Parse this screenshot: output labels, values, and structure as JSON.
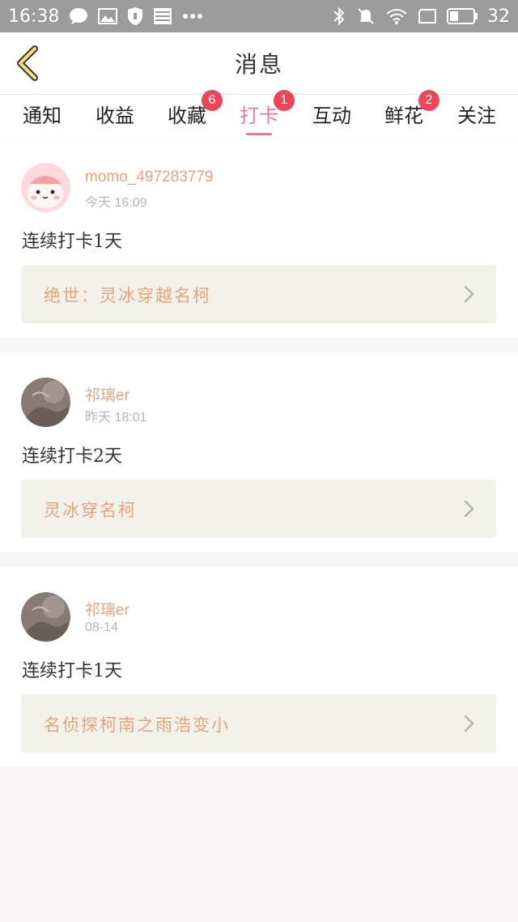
{
  "status_bar": {
    "time": "16:38",
    "battery_percent": "32",
    "icons": [
      "chat-icon",
      "image-icon",
      "shield-icon",
      "news-icon",
      "more-dots-icon",
      "bluetooth-icon",
      "mute-icon",
      "wifi-icon",
      "screen-icon",
      "battery-icon"
    ]
  },
  "header": {
    "title": "消息",
    "back_icon": "chevron-left-icon"
  },
  "tabs": [
    {
      "label": "通知",
      "badge": ""
    },
    {
      "label": "收益",
      "badge": ""
    },
    {
      "label": "收藏",
      "badge": "6"
    },
    {
      "label": "打卡",
      "badge": "1",
      "active": true
    },
    {
      "label": "互动",
      "badge": ""
    },
    {
      "label": "鲜花",
      "badge": "2"
    },
    {
      "label": "关注",
      "badge": ""
    }
  ],
  "colors": {
    "accent_pink": "#e07aa2",
    "badge_red": "#f04458",
    "username_orange": "#e3a47e",
    "book_bg": "#f3f2ea"
  },
  "feed": [
    {
      "username": "momo_497283779",
      "time": "今天  16:09",
      "message": "连续打卡1天",
      "book": "绝世：灵冰穿越名柯"
    },
    {
      "username": "祁璃er",
      "time": "昨天  18:01",
      "message": "连续打卡2天",
      "book": "灵冰穿名柯"
    },
    {
      "username": "祁璃er",
      "time": "08-14",
      "message": "连续打卡1天",
      "book": "名侦探柯南之雨浩变小"
    }
  ]
}
